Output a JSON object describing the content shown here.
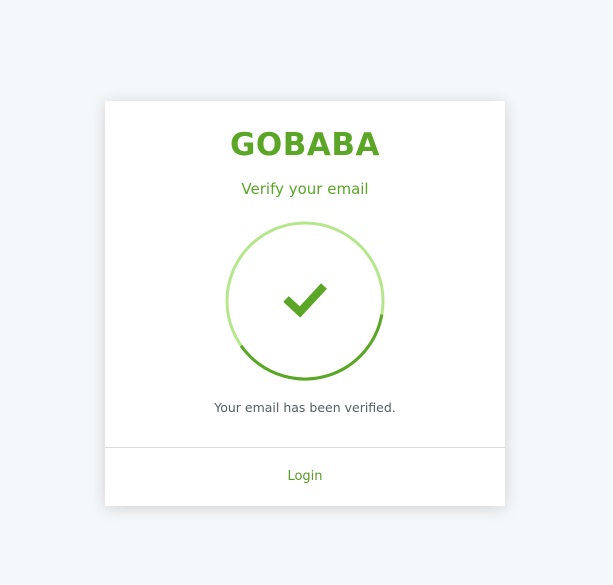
{
  "brand": {
    "logo_text": "GOBABA",
    "color": "#5ba626"
  },
  "verify": {
    "title": "Verify your email",
    "message": "Your email has been verified.",
    "status_icon": "checkmark-icon",
    "progress_fraction": 0.3,
    "ring_light_color": "#b6e68c",
    "ring_dark_color": "#5ba626"
  },
  "footer": {
    "login_label": "Login"
  }
}
